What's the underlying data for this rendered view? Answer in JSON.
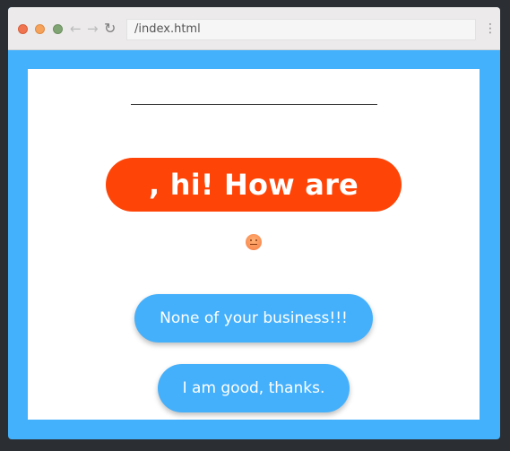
{
  "browser": {
    "url": "/index.html",
    "nav_back": "←",
    "nav_forward": "→",
    "reload": "↻",
    "menu": "⋮"
  },
  "page": {
    "greeting": ", hi! How are you?",
    "emoji": "neutral-face-emoji",
    "replies": [
      "None of your business!!!",
      "I am good, thanks."
    ]
  },
  "colors": {
    "frame_blue": "#43b1fc",
    "greeting_orange": "#ff4407",
    "button_blue": "#44b0fc"
  }
}
